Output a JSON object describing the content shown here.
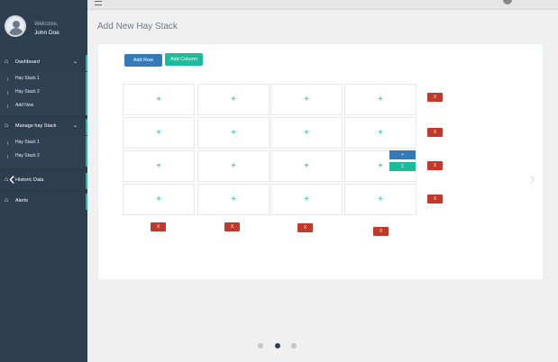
{
  "user": {
    "welcome": "Welcome,",
    "name": "John Doe"
  },
  "sidebar": {
    "sections": [
      {
        "label": "Dashboard",
        "icon": "home-icon",
        "chevron": "⌄"
      },
      {
        "label": "Manage hay Stack",
        "icon": "home-icon",
        "chevron": "⌄"
      },
      {
        "label": "Historic Data",
        "icon": "home-icon"
      },
      {
        "label": "Alerts",
        "icon": "home-icon"
      }
    ],
    "dashboard_items": [
      "Hay Stack 1",
      "Hay Stack 2",
      "Add New"
    ],
    "manage_items": [
      "Hay Stack 1",
      "Hay Stack 2"
    ]
  },
  "page": {
    "title": "Add New Hay Stack"
  },
  "toolbar": {
    "add_row": "Add Row",
    "add_column": "Add Column"
  },
  "grid": {
    "cell_symbol": "+",
    "row_delete": "X",
    "col_delete": "X"
  },
  "side_controls": {
    "blue_label": "+",
    "green_label": "1"
  },
  "carousel": {
    "prev": "‹",
    "next": "›",
    "active_index": 1,
    "count": 3
  }
}
